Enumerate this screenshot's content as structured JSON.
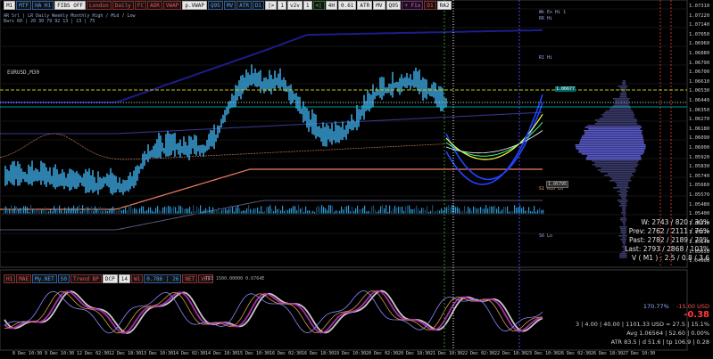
{
  "toolbar": [
    {
      "label": "M1",
      "style": "white"
    },
    {
      "label": "MTF",
      "style": "blue"
    },
    {
      "label": "HA H1",
      "style": "blue"
    },
    {
      "label": "FIBS OFF",
      "style": "white"
    },
    {
      "label": "London",
      "style": "red"
    },
    {
      "label": "Daily",
      "style": "red"
    },
    {
      "label": "FC",
      "style": "red"
    },
    {
      "label": "ADR",
      "style": "red"
    },
    {
      "label": "VWAP",
      "style": "red"
    },
    {
      "label": "p.VWAP",
      "style": "white"
    },
    {
      "label": "Q95",
      "style": "blue"
    },
    {
      "label": "MV",
      "style": "blue"
    },
    {
      "label": "ATR",
      "style": "blue"
    },
    {
      "label": "D1",
      "style": "blue"
    },
    {
      "label": "|>",
      "style": "white"
    },
    {
      "label": "1",
      "style": "white"
    },
    {
      "label": "v2v",
      "style": "white"
    },
    {
      "label": "1",
      "style": "white"
    },
    {
      "label": "<|",
      "style": "green"
    },
    {
      "label": "4H",
      "style": "white"
    },
    {
      "label": "0.61",
      "style": "white"
    },
    {
      "label": "ATR",
      "style": "white"
    },
    {
      "label": "MV",
      "style": "white"
    },
    {
      "label": "Q95",
      "style": "white"
    },
    {
      "label": "+ Fix",
      "style": "mag"
    },
    {
      "label": "D1",
      "style": "red"
    },
    {
      "label": "RA2",
      "style": "white"
    }
  ],
  "symbol": "EURUSD,M30",
  "mini_header": [
    "AR  Srl | LR   Daily   Weekly   Monthly   High / Mid / Low",
    "Bars  60 | 20   30     79      92      13 | 13 | 75"
  ],
  "indicator_toolbar": [
    {
      "label": "H1",
      "style": "red"
    },
    {
      "label": "MAE",
      "style": "red"
    },
    {
      "label": "My.NET",
      "style": "blue"
    },
    {
      "label": "S0",
      "style": "blue"
    },
    {
      "label": "Trend BP",
      "style": "red"
    },
    {
      "label": "DCP",
      "style": "white"
    },
    {
      "label": "14",
      "style": "white"
    },
    {
      "label": "W1",
      "style": "red"
    },
    {
      "label": "0.786 | 26",
      "style": "blue"
    },
    {
      "label": "NET",
      "style": "red"
    },
    {
      "label": "VHF",
      "style": "red"
    }
  ],
  "indicator_caption": "T13 1500.00000 0.6764E",
  "stats": [
    "W: 2743 / 820 / 30%",
    "Prev: 2762 / 2111 / 76%",
    "Past: 2782 / 2189 / 79%",
    "Last: 2793 / 2868 / 103%",
    "V ( M1 ) : 2.5 / 0.8 / 3.6"
  ],
  "account": {
    "pct": "170.77%",
    "usd": "-15.00 USD",
    "pnl": "-0.38",
    "line1": "3  |  4.00  |  40.00  |  1101.33 USD = 27.5  |  15.1%",
    "line2": "Avg 1.06564  |  52.60  |  0.00%",
    "line3": "ATR 83.5  |  d 51.6  |  tp 106.9  |  0.28"
  },
  "y_axis": [
    "1.07310",
    "1.07220",
    "1.07140",
    "1.07050",
    "1.06960",
    "1.06880",
    "1.06790",
    "1.06700",
    "1.06610",
    "1.06530",
    "1.06440",
    "1.06350",
    "1.06270",
    "1.06180",
    "1.06090",
    "1.06000",
    "1.05920",
    "1.05830",
    "1.05740",
    "1.05660",
    "1.05570",
    "1.05480",
    "1.05400",
    "1.05310",
    "1.05220",
    "1.05140",
    "1.05050",
    "1.04960"
  ],
  "x_axis": [
    "8 Dec 10:30",
    "9 Dec 10:30",
    "12 Dec 02:30",
    "12 Dec 18:30",
    "13 Dec 10:30",
    "14 Dec 02:30",
    "14 Dec 18:30",
    "15 Dec 10:30",
    "16 Dec 02:30",
    "16 Dec 18:30",
    "19 Dec 10:30",
    "20 Dec 02:30",
    "20 Dec 18:30",
    "21 Dec 10:30",
    "22 Dec 02:30",
    "22 Dec 18:30",
    "23 Dec 10:30",
    "26 Dec 02:30",
    "26 Dec 18:30",
    "27 Dec 10:30"
  ],
  "price_tags": [
    {
      "text": "1.06677",
      "color": "#00d0d0"
    },
    {
      "text": "1.05795",
      "color": "#c8c8c8"
    }
  ],
  "level_labels": [
    "R1 Hi",
    "R6 Hi",
    "S1 Mid Lo",
    "S6 Lo",
    "Wk Ex Hi 1"
  ],
  "colors": {
    "bg": "#000000",
    "candle": "#3aa0d8",
    "vwap": "#ffffff",
    "upper": "#1c1c8c"
  }
}
